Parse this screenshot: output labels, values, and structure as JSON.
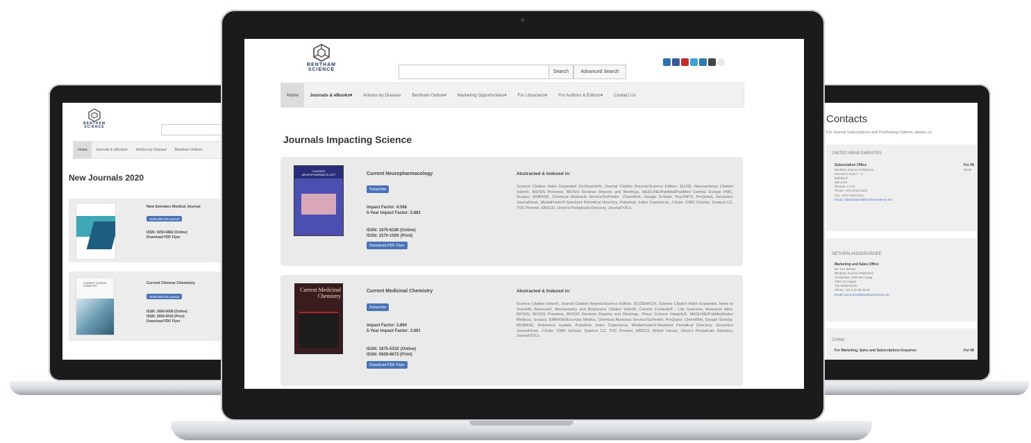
{
  "brand": {
    "line1": "BENTHAM",
    "line2": "SCIENCE"
  },
  "search": {
    "button": "Search",
    "advanced": "Advanced Search"
  },
  "nav": [
    "Home",
    "Journals & eBooks▾",
    "Articles by Disease",
    "Bentham Online▾",
    "Marketing Opportunities▾",
    "For Librarians▾",
    "For Authors & Editors▾",
    "Contact Us"
  ],
  "social_icons": [
    "linkedin-icon",
    "facebook-icon",
    "youtube-icon",
    "twitter-icon",
    "wordpress-icon",
    "instagram-icon",
    "rss-icon"
  ],
  "center": {
    "heading": "Journals Impacting Science",
    "journals": [
      {
        "name": "Current Neuropharmacology",
        "subscribe": "Subscribe",
        "impact": "Impact Factor: 4.568",
        "impact5": "5-Year Impact Factor: 5.883",
        "issn_online": "ISSN: 1875-6190 (Online)",
        "issn_print": "ISSN: 1570-159X (Print)",
        "download": "Download PDF Flyer",
        "abs_title": "Abstracted & Indexed in:",
        "abs_text": "Science Citation Index Expanded (SciSearch®), Journal Citation Reports/Science Edition, EC/ISI, Neuroscience Citation Index®, BIOSIS Previews, BIOSIS Reviews Reports and Meetings, MEDLINE/PubMed/PubMed Central, Europe PMC, Scopus, EMBASE, Chemical Abstracts Service/SciFinder, ChemWeb, Google Scholar, PsycINFO, ProQuest, Genamics JournalSeek, MediaFinder®-Standard Periodical Directory, PubsHub, Index Copernicus, J-Gate, CNKI Scholar, Suweco CZ, TOC Premier, EBSCO, Ulrich's Periodicals Directory, JournalTOCs.",
        "cover_title": "CURRENT NEUROPHARMACOLOGY",
        "cover_color": "#4a4fb0"
      },
      {
        "name": "Current Medicinal Chemistry",
        "subscribe": "Subscribe",
        "impact": "Impact Factor: 3.894",
        "impact5": "5-Year Impact Factor: 3.691",
        "issn_online": "ISSN: 1875-533X (Online)",
        "issn_print": "ISSN: 0929-8673 (Print)",
        "download": "Download PDF Flyer",
        "abs_title": "Abstracted & Indexed in:",
        "abs_text": "Science Citation Index®, Journal Citation Reports/Science Edition, SCISEARCH, Science Citation Index Expanded, Index to Scientific Reviews®, Biochemistry and Biophysics Citation Index®, Current Contents® - Life Sciences, Research Alert, BIOSIS, BIOSIS Previews, BIOSIS Reviews Reports and Meetings, Prous Science Integrity®, MEDLINE/PubMed/Index Medicus, Scopus, EMBASE/Excerpta Medica, Chemical Abstracts Service/SciFinder, ProQuest, ChemWeb, Google Scholar, BIOBASE, Reference Update, PubsHub, Index Copernicus, MediaFinder®-Standard Periodical Directory, Genamics JournalSeek, J-Gate, CNKI Scholar, Suweco CZ, TOC Premier, EBSCO, British Library, Ulrich's Periodicals Directory, JournalTOCs.",
        "cover_title": "Current Medicinal Chemistry",
        "cover_color": "#3a1b1e"
      }
    ]
  },
  "left": {
    "heading": "New Journals 2020",
    "journals": [
      {
        "name": "New Emirates Medical Journal",
        "button": "Subscribe this journal",
        "issn1": "ISSN: 0250-6882 (Online)",
        "issn2": "Download PDF Flyer"
      },
      {
        "name": "Current Chinese Chemistry",
        "button": "Subscribe this journal",
        "issn1": "ISSN: 2666-0008 (Online)",
        "issn2": "ISSN: 2666-0016 (Print)",
        "issn3": "Download PDF Flyer"
      }
    ]
  },
  "right": {
    "heading": "Contacts",
    "intro": "For Journal Subscriptions and Purchasing Options, please co",
    "sections": [
      {
        "region": "UNITED ARAB EMIRATES",
        "office": "Subscription Office",
        "lines": [
          "Bentham Science Publishers",
          "Executive Suite Y - 2",
          "Building F",
          "Sail Zone",
          "Sharjah, U.A.E.",
          "Phone: +971-6-5571132",
          "Fax: +971-6-5571134",
          "Email: subscriptions@benthamscience.net"
        ],
        "right_label": "For Mi",
        "right_sub": "Email"
      },
      {
        "region": "NETHERLANDS/EUROPE",
        "office": "Marketing and Sales Office",
        "lines": [
          "Mr. Tom Bonsel",
          "Bentham Science Publishers",
          "Amsterdam 1000 Den Haag",
          "2582 CN Hague",
          "The Netherlands",
          "Phone: +31 6 52 08 28 00",
          "Email: tom.bonsel@benthamscience.net"
        ],
        "right_label": "",
        "right_sub": ""
      },
      {
        "region": "CHINA",
        "office": "For Marketing, Sales and Subscriptions Enquiries",
        "lines": [],
        "right_label": "For Mi",
        "right_sub": ""
      }
    ]
  }
}
